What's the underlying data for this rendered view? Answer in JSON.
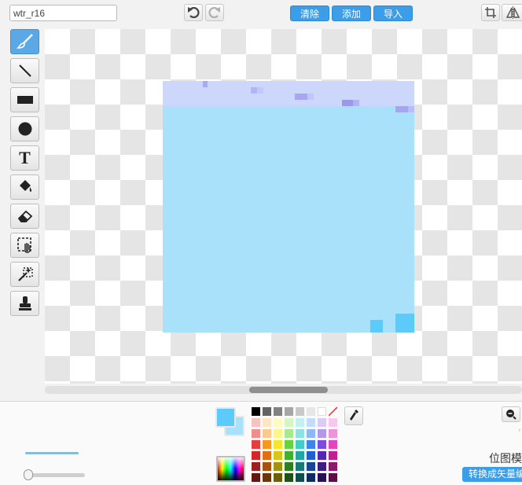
{
  "costume": {
    "name": "wtr_r16"
  },
  "toolbar": {
    "undo_icon": "undo-icon",
    "redo_icon": "redo-icon",
    "clear_label": "清除",
    "add_label": "添加",
    "import_label": "导入",
    "crop_icon": "crop-icon",
    "flip_icon": "flip-horizontal-icon"
  },
  "tools": [
    {
      "name": "brush",
      "icon": "brush-icon",
      "active": true
    },
    {
      "name": "line",
      "icon": "line-icon"
    },
    {
      "name": "rectangle",
      "icon": "rectangle-icon"
    },
    {
      "name": "ellipse",
      "icon": "ellipse-icon"
    },
    {
      "name": "text",
      "icon": "text-icon",
      "glyph": "T"
    },
    {
      "name": "fill",
      "icon": "paint-bucket-icon"
    },
    {
      "name": "eraser",
      "icon": "eraser-icon"
    },
    {
      "name": "select",
      "icon": "select-icon"
    },
    {
      "name": "magic-select",
      "icon": "magic-wand-icon"
    },
    {
      "name": "stamp",
      "icon": "stamp-icon"
    }
  ],
  "colors": {
    "accent": "#3c9ee8",
    "foreground": "#5ccbfb",
    "background": "#a9e1fb",
    "costume_fill": "#a9e1fb",
    "costume_band": "#cdd7fb"
  },
  "bottom": {
    "mode_label": "位图模",
    "convert_label": "转换成矢量编"
  }
}
